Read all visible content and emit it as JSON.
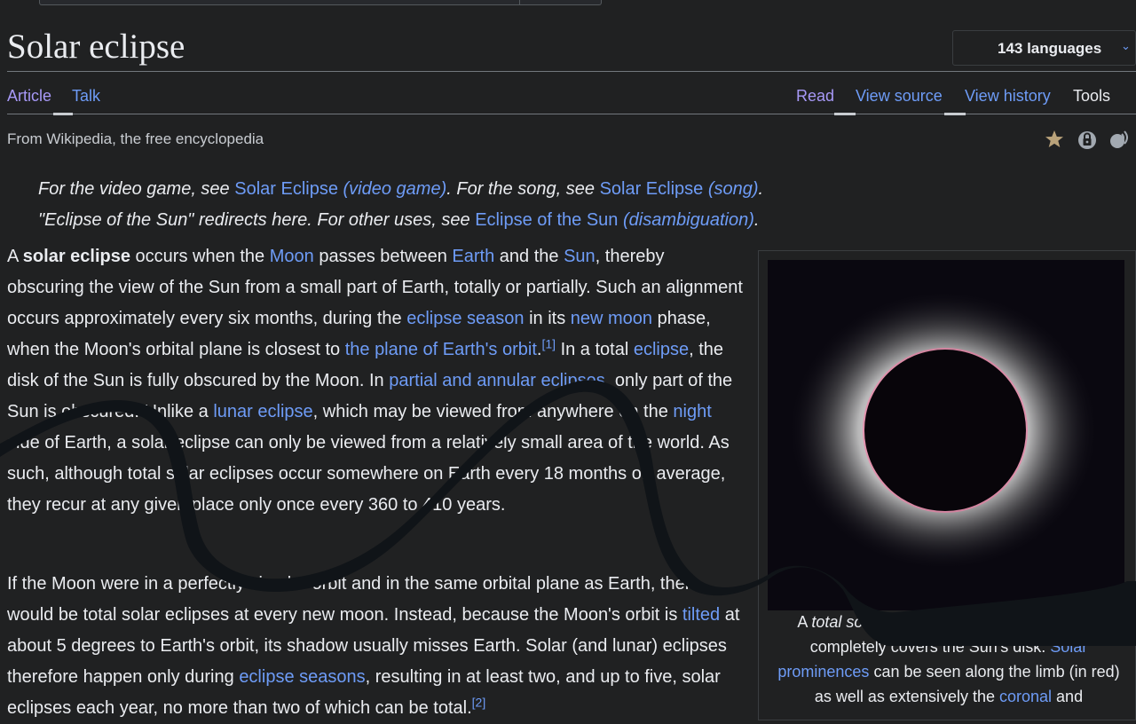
{
  "page": {
    "title": "Solar eclipse",
    "languages_label": "143 languages",
    "tagline": "From Wikipedia, the free encyclopedia"
  },
  "tabs": {
    "article": "Article",
    "talk": "Talk",
    "read": "Read",
    "view_source": "View source",
    "view_history": "View history",
    "tools": "Tools"
  },
  "hatnote": {
    "line1_prefix": "For the video game, see ",
    "line1_link1_a": "Solar Eclipse",
    "line1_link1_b": "(video game)",
    "line1_mid": ". For the song, see ",
    "line1_link2_a": "Solar Eclipse",
    "line1_link2_b": "(song)",
    "line1_end": ".",
    "line2_prefix": "\"Eclipse of the Sun\" redirects here. For other uses, see ",
    "line2_link_a": "Eclipse of the Sun",
    "line2_link_b": "(disambiguation)",
    "line2_end": "."
  },
  "para1": {
    "t1": "A ",
    "bold": "solar eclipse",
    "t2": " occurs when the ",
    "l_moon": "Moon",
    "t3": " passes between ",
    "l_earth": "Earth",
    "t4": " and the ",
    "l_sun": "Sun",
    "t5": ", thereby obscuring the view of the Sun from a small part of Earth, totally or partially. Such an alignment occurs approximately every six months, during the ",
    "l_eclipse_season": "eclipse season",
    "t6": " in its ",
    "l_new_moon": "new moon",
    "t7": " phase, when the Moon's orbital plane is closest to ",
    "l_plane": "the plane of Earth's orbit",
    "t8": ".",
    "ref1": "[1]",
    "t9": " In a total ",
    "l_eclipse": "eclipse",
    "t10": ", the disk of the Sun is fully obscured by the Moon. In ",
    "l_partial": "partial and annular eclipses",
    "t11": ", only part of the Sun is obscured. Unlike a ",
    "l_lunar": "lunar eclipse",
    "t12": ", which may be viewed from anywhere on the ",
    "l_night": "night",
    "t13": " side of Earth, a solar eclipse can only be viewed from a relatively small area of the world. As such, although total solar eclipses occur somewhere on Earth every 18 months on average, they recur at any given place only once every 360 to 410 years."
  },
  "para2": {
    "t1": "If the Moon were in a perfectly circular orbit and in the same orbital plane as Earth, there would be total solar eclipses at every new moon. Instead, because the Moon's orbit is ",
    "l_tilted": "tilted",
    "t2": " at about 5 degrees to Earth's orbit, its shadow usually misses Earth. Solar (and lunar) eclipses therefore happen only during ",
    "l_eclipse_seasons": "eclipse seasons",
    "t3": ", resulting in at least two, and up to five, solar eclipses each year, no more than two of which can be total.",
    "ref2": "[2]"
  },
  "infobox": {
    "cap_t1": "A ",
    "cap_i": "total solar eclipse",
    "cap_t2": " occurs when the Moon completely covers the Sun's disk. ",
    "cap_l1": "Solar prominences",
    "cap_t3": " can be seen along the limb (in red) as well as extensively the ",
    "cap_l2": "coronal",
    "cap_t4": " and"
  },
  "colors": {
    "background": "#202122",
    "text": "#eaecf0",
    "link": "#6e9cf7",
    "visited_tab": "#a799f7",
    "scribble": "#101418"
  },
  "icons": {
    "featured": "star-icon",
    "protection": "lock-icon",
    "spoken": "audio-icon"
  }
}
